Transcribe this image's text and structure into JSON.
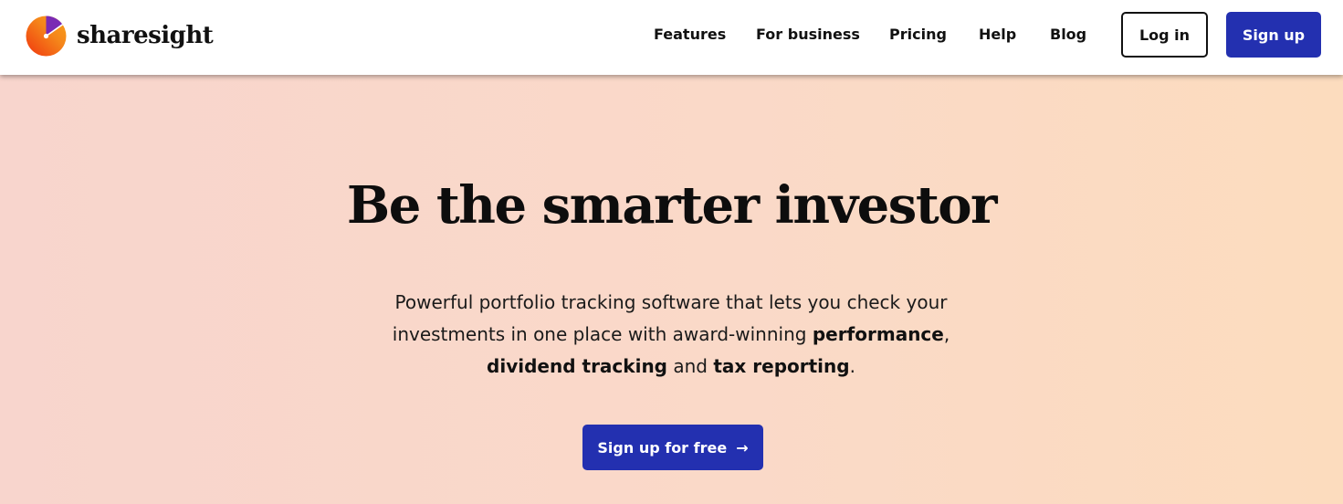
{
  "brand": {
    "name": "sharesight",
    "logo_icon": "gauge-dial-icon",
    "logo_colors": [
      "#f0440d",
      "#f58a12",
      "#7a2ab4"
    ]
  },
  "nav": {
    "features": "Features",
    "for_business": "For business",
    "pricing": "Pricing",
    "help": "Help",
    "blog": "Blog",
    "login": "Log in",
    "signup": "Sign up"
  },
  "hero": {
    "title": "Be the smarter investor",
    "desc_part1": "Powerful portfolio tracking software that lets you check your investments in one place with award-winning ",
    "desc_bold1": "performance",
    "desc_part2": ", ",
    "desc_bold2": "dividend tracking",
    "desc_part3": " and ",
    "desc_bold3": "tax reporting",
    "desc_part4": ".",
    "cta_label": "Sign up for free",
    "cta_icon": "arrow-right-icon"
  },
  "colors": {
    "primary": "#2330b0",
    "hero_bg_start": "#f8d5cd",
    "hero_bg_end": "#fcdcbe"
  }
}
